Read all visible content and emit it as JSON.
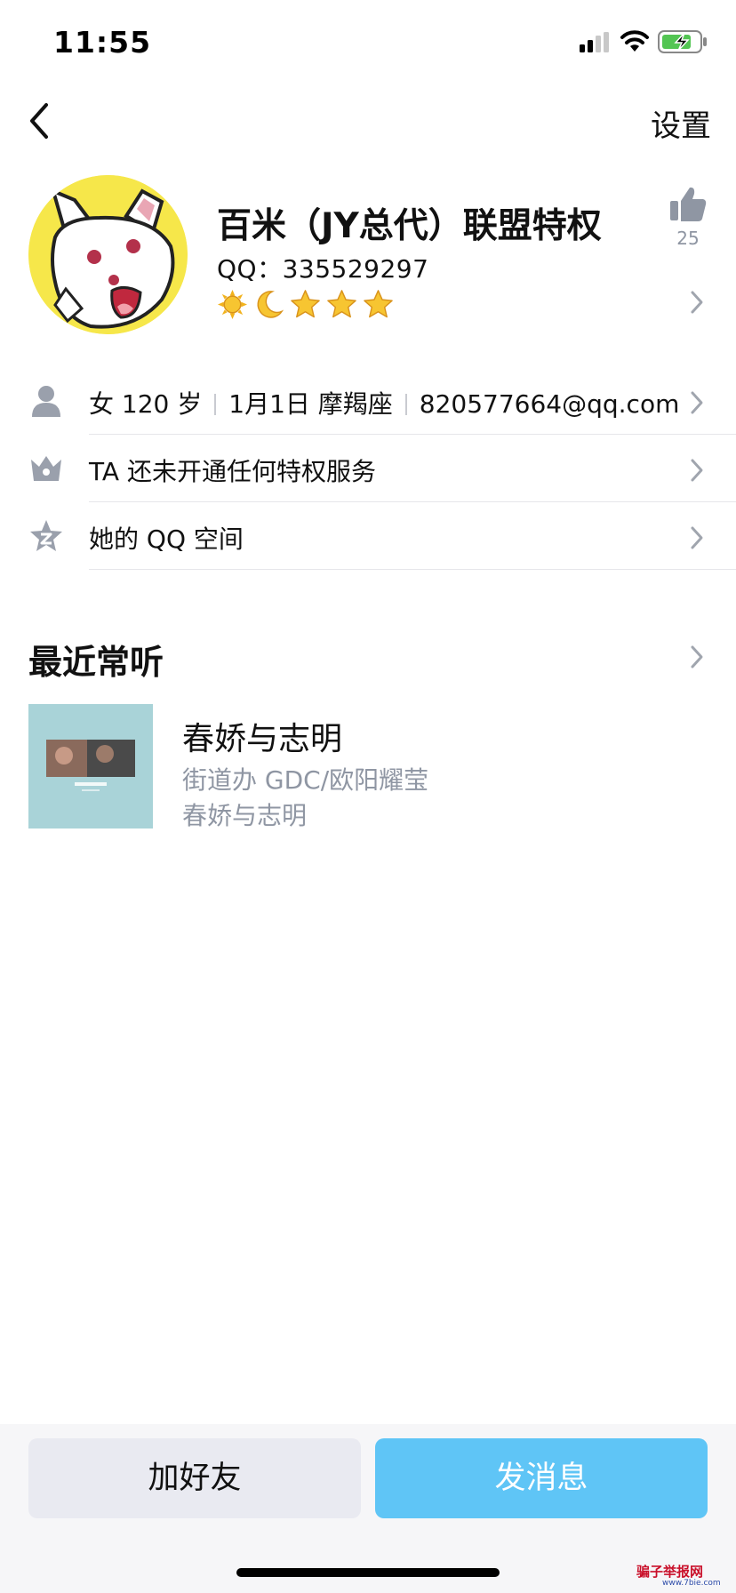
{
  "status_bar": {
    "time": "11:55"
  },
  "nav": {
    "settings_label": "设置"
  },
  "profile": {
    "nickname": "百米（JY总代）联盟特权",
    "qq_label": "QQ：",
    "qq_number": "335529297",
    "level_icons": [
      "sun-icon",
      "moon-icon",
      "star-icon",
      "star-icon",
      "star-icon"
    ],
    "like_count": "25"
  },
  "info_rows": {
    "basic": {
      "gender_age": "女 120 岁",
      "birthday": "1月1日 摩羯座",
      "email": "820577664@qq.com"
    },
    "vip": {
      "text": "TA 还未开通任何特权服务"
    },
    "qzone": {
      "text": "她的 QQ 空间"
    }
  },
  "recent": {
    "title": "最近常听",
    "song": {
      "title": "春娇与志明",
      "artist": "街道办 GDC/欧阳耀莹",
      "album": "春娇与志明"
    }
  },
  "actions": {
    "add_friend": "加好友",
    "send_message": "发消息"
  },
  "watermark": {
    "text": "骗子举报网",
    "url": "www.7bie.com"
  },
  "colors": {
    "accent": "#5fc5f6",
    "avatar_bg": "#f6e74a",
    "muted_text": "#8f96a3"
  }
}
